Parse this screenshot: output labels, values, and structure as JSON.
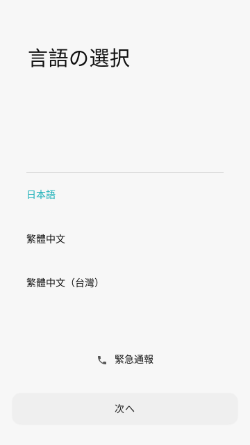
{
  "header": {
    "title": "言語の選択"
  },
  "languages": {
    "items": [
      {
        "label": "日本語",
        "selected": true
      },
      {
        "label": "繁體中文",
        "selected": false
      },
      {
        "label": "繁體中文（台灣）",
        "selected": false
      }
    ]
  },
  "emergency": {
    "icon": "phone-icon",
    "label": "緊急通報"
  },
  "footer": {
    "next_label": "次へ"
  },
  "colors": {
    "accent": "#1ab0b8",
    "background": "#f7f7f7",
    "text": "#111111",
    "divider": "#cfcfcf",
    "button_background": "#efefef"
  }
}
